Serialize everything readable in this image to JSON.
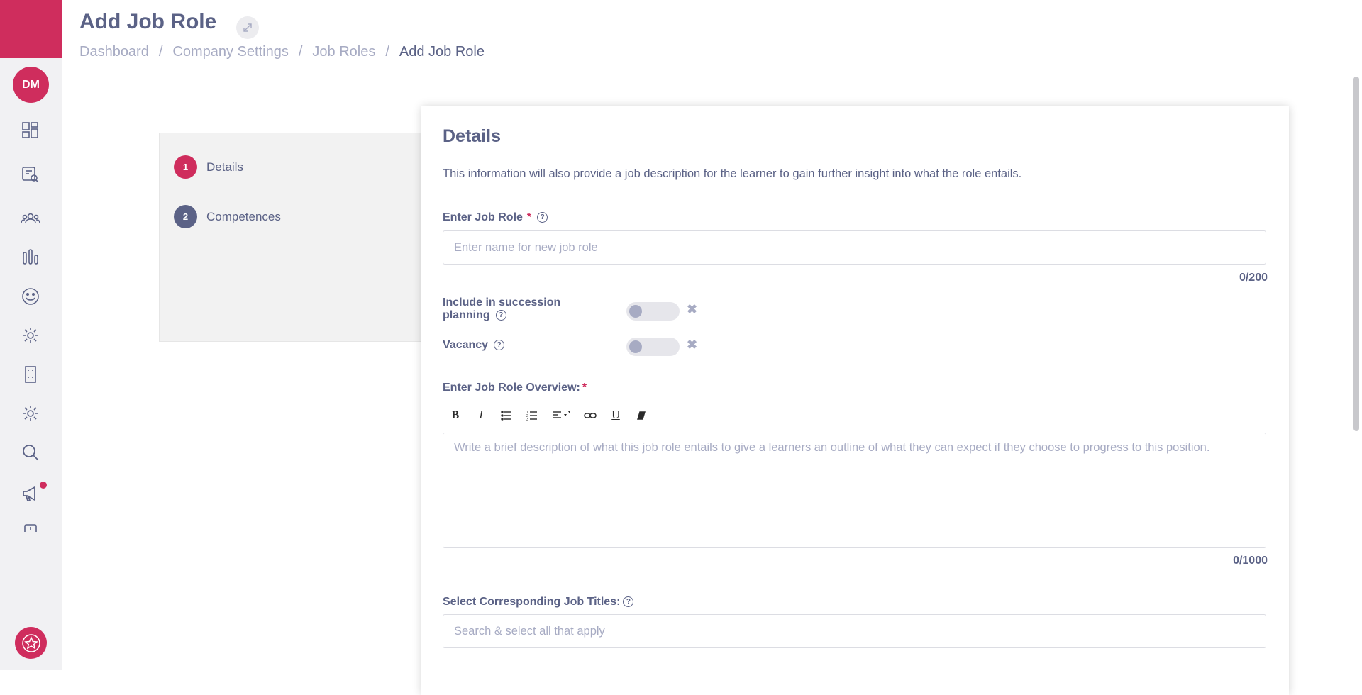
{
  "sidebar": {
    "avatar_initials": "DM",
    "icons": [
      "dashboard-icon",
      "search-document-icon",
      "people-icon",
      "bar-chart-icon",
      "smiley-icon",
      "gear-icon",
      "building-icon",
      "gear-icon",
      "search-icon",
      "megaphone-icon",
      "chat-icon"
    ],
    "brand_color": "#cf2d5d"
  },
  "header": {
    "title": "Add Job Role",
    "breadcrumb": [
      "Dashboard",
      "Company Settings",
      "Job Roles",
      "Add Job Role"
    ]
  },
  "steps": [
    {
      "number": "1",
      "label": "Details",
      "color": "#cf2d5d"
    },
    {
      "number": "2",
      "label": "Competences",
      "color": "#5b6286"
    }
  ],
  "form": {
    "title": "Details",
    "description": "This information will also provide a job description for the learner to gain further insight into what the role entails.",
    "job_role": {
      "label": "Enter Job Role",
      "required_mark": "*",
      "placeholder": "Enter name for new job role",
      "value": "",
      "counter": "0/200"
    },
    "succession": {
      "label_line1": "Include in succession",
      "label_line2": "planning",
      "enabled": false
    },
    "vacancy": {
      "label": "Vacancy",
      "enabled": false
    },
    "overview": {
      "label": "Enter Job Role Overview:",
      "required_mark": "*",
      "placeholder": "Write a brief description of what this job role entails to give a learners an outline of what they can expect if they choose to progress to this position.",
      "counter": "0/1000",
      "toolbar": [
        "bold",
        "italic",
        "bullet-list",
        "numbered-list",
        "align",
        "link",
        "underline",
        "clear-format"
      ]
    },
    "job_titles": {
      "label": "Select Corresponding Job Titles:",
      "placeholder": "Search & select all that apply"
    }
  }
}
